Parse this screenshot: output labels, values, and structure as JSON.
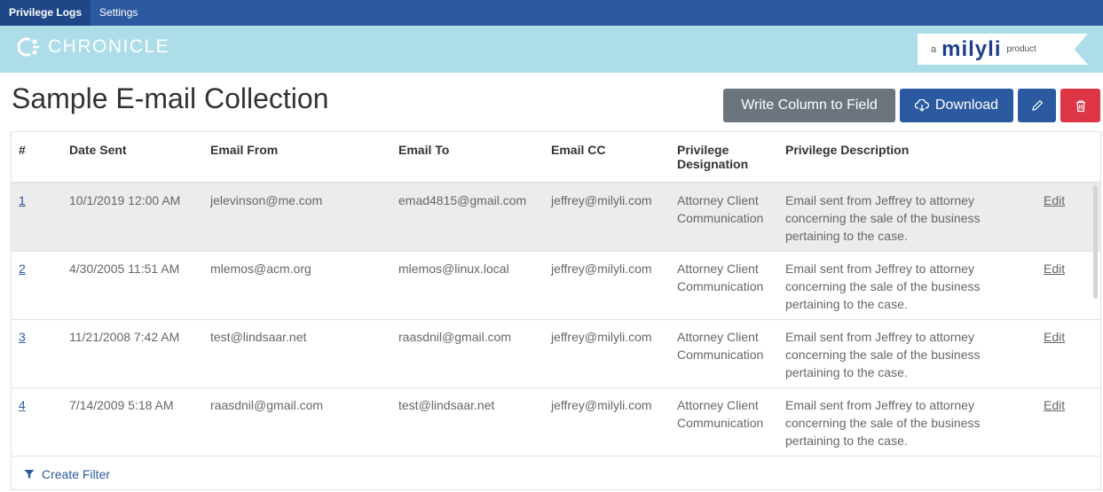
{
  "nav": {
    "tabs": [
      {
        "label": "Privilege Logs",
        "active": true
      },
      {
        "label": "Settings",
        "active": false
      }
    ]
  },
  "brand": {
    "name": "CHRONICLE",
    "icon": "chronicle-logo-icon",
    "partner_prefix": "a",
    "partner_name": "milyli",
    "partner_suffix": "product"
  },
  "page": {
    "title": "Sample E-mail Collection"
  },
  "toolbar": {
    "write_label": "Write Column to Field",
    "download_label": "Download",
    "download_icon": "cloud-download-icon",
    "edit_icon": "pencil-icon",
    "delete_icon": "trash-icon"
  },
  "table": {
    "headers": [
      "#",
      "Date Sent",
      "Email From",
      "Email To",
      "Email CC",
      "Privilege Designation",
      "Privilege Description",
      ""
    ],
    "rows": [
      {
        "num": "1",
        "date": "10/1/2019 12:00 AM",
        "from": "jelevinson@me.com",
        "to": "emad4815@gmail.com",
        "cc": "jeffrey@milyli.com",
        "designation": "Attorney Client Communication",
        "description": "Email sent from Jeffrey to attorney concerning the sale of the business pertaining to the case.",
        "edit": "Edit"
      },
      {
        "num": "2",
        "date": "4/30/2005 11:51 AM",
        "from": "mlemos@acm.org",
        "to": "mlemos@linux.local",
        "cc": "jeffrey@milyli.com",
        "designation": "Attorney Client Communication",
        "description": "Email sent from Jeffrey to attorney concerning the sale of the business pertaining to the case.",
        "edit": "Edit"
      },
      {
        "num": "3",
        "date": "11/21/2008 7:42 AM",
        "from": "test@lindsaar.net",
        "to": "raasdnil@gmail.com",
        "cc": "jeffrey@milyli.com",
        "designation": "Attorney Client Communication",
        "description": "Email sent from Jeffrey to attorney concerning the sale of the business pertaining to the case.",
        "edit": "Edit"
      },
      {
        "num": "4",
        "date": "7/14/2009 5:18 AM",
        "from": "raasdnil@gmail.com",
        "to": "test@lindsaar.net",
        "cc": "jeffrey@milyli.com",
        "designation": "Attorney Client Communication",
        "description": "Email sent from Jeffrey to attorney concerning the sale of the business pertaining to the case.",
        "edit": "Edit"
      }
    ]
  },
  "footer": {
    "filter_label": "Create Filter",
    "filter_icon": "funnel-icon"
  },
  "colors": {
    "nav": "#2c5aa0",
    "brandbar": "#acdde9",
    "primary": "#2c5aa0",
    "secondary": "#6c757d",
    "danger": "#dc3545"
  }
}
